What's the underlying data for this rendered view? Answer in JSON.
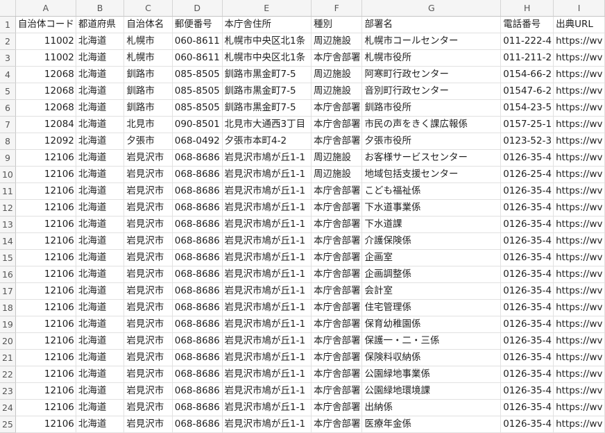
{
  "columns": [
    "A",
    "B",
    "C",
    "D",
    "E",
    "F",
    "G",
    "H",
    "I"
  ],
  "rows": [
    {
      "num": "1",
      "cells": [
        "自治体コード",
        "都道府県",
        "自治体名",
        "郵便番号",
        "本庁舎住所",
        "種別",
        "部署名",
        "電話番号",
        "出典URL"
      ]
    },
    {
      "num": "2",
      "cells": [
        "11002",
        "北海道",
        "札幌市",
        "060-8611",
        "札幌市中央区北1条",
        "周辺施設",
        "札幌市コールセンター",
        "011-222-4",
        "https://wv"
      ]
    },
    {
      "num": "3",
      "cells": [
        "11002",
        "北海道",
        "札幌市",
        "060-8611",
        "札幌市中央区北1条",
        "本庁舎部署",
        "札幌市役所",
        "011-211-2",
        "https://wv"
      ]
    },
    {
      "num": "4",
      "cells": [
        "12068",
        "北海道",
        "釧路市",
        "085-8505",
        "釧路市黒金町7-5",
        "周辺施設",
        "阿寒町行政センター",
        "0154-66-2",
        "https://wv"
      ]
    },
    {
      "num": "5",
      "cells": [
        "12068",
        "北海道",
        "釧路市",
        "085-8505",
        "釧路市黒金町7-5",
        "周辺施設",
        "音別町行政センター",
        "01547-6-2",
        "https://wv"
      ]
    },
    {
      "num": "6",
      "cells": [
        "12068",
        "北海道",
        "釧路市",
        "085-8505",
        "釧路市黒金町7-5",
        "本庁舎部署",
        "釧路市役所",
        "0154-23-5",
        "https://wv"
      ]
    },
    {
      "num": "7",
      "cells": [
        "12084",
        "北海道",
        "北見市",
        "090-8501",
        "北見市大通西3丁目",
        "本庁舎部署",
        "市民の声をきく課広報係",
        "0157-25-1",
        "https://wv"
      ]
    },
    {
      "num": "8",
      "cells": [
        "12092",
        "北海道",
        "夕張市",
        "068-0492",
        "夕張市本町4-2",
        "本庁舎部署",
        "夕張市役所",
        "0123-52-3",
        "https://wv"
      ]
    },
    {
      "num": "9",
      "cells": [
        "12106",
        "北海道",
        "岩見沢市",
        "068-8686",
        "岩見沢市鳩が丘1-1",
        "周辺施設",
        "お客様サービスセンター",
        "0126-35-4",
        "https://wv"
      ]
    },
    {
      "num": "10",
      "cells": [
        "12106",
        "北海道",
        "岩見沢市",
        "068-8686",
        "岩見沢市鳩が丘1-1",
        "周辺施設",
        "地域包括支援センター",
        "0126-25-4",
        "https://wv"
      ]
    },
    {
      "num": "11",
      "cells": [
        "12106",
        "北海道",
        "岩見沢市",
        "068-8686",
        "岩見沢市鳩が丘1-1",
        "本庁舎部署",
        "こども福祉係",
        "0126-35-4",
        "https://wv"
      ]
    },
    {
      "num": "12",
      "cells": [
        "12106",
        "北海道",
        "岩見沢市",
        "068-8686",
        "岩見沢市鳩が丘1-1",
        "本庁舎部署",
        "下水道事業係",
        "0126-35-4",
        "https://wv"
      ]
    },
    {
      "num": "13",
      "cells": [
        "12106",
        "北海道",
        "岩見沢市",
        "068-8686",
        "岩見沢市鳩が丘1-1",
        "本庁舎部署",
        "下水道課",
        "0126-35-4",
        "https://wv"
      ]
    },
    {
      "num": "14",
      "cells": [
        "12106",
        "北海道",
        "岩見沢市",
        "068-8686",
        "岩見沢市鳩が丘1-1",
        "本庁舎部署",
        "介護保険係",
        "0126-35-4",
        "https://wv"
      ]
    },
    {
      "num": "15",
      "cells": [
        "12106",
        "北海道",
        "岩見沢市",
        "068-8686",
        "岩見沢市鳩が丘1-1",
        "本庁舎部署",
        "企画室",
        "0126-35-4",
        "https://wv"
      ]
    },
    {
      "num": "16",
      "cells": [
        "12106",
        "北海道",
        "岩見沢市",
        "068-8686",
        "岩見沢市鳩が丘1-1",
        "本庁舎部署",
        "企画調整係",
        "0126-35-4",
        "https://wv"
      ]
    },
    {
      "num": "17",
      "cells": [
        "12106",
        "北海道",
        "岩見沢市",
        "068-8686",
        "岩見沢市鳩が丘1-1",
        "本庁舎部署",
        "会計室",
        "0126-35-4",
        "https://wv"
      ]
    },
    {
      "num": "18",
      "cells": [
        "12106",
        "北海道",
        "岩見沢市",
        "068-8686",
        "岩見沢市鳩が丘1-1",
        "本庁舎部署",
        "住宅管理係",
        "0126-35-4",
        "https://wv"
      ]
    },
    {
      "num": "19",
      "cells": [
        "12106",
        "北海道",
        "岩見沢市",
        "068-8686",
        "岩見沢市鳩が丘1-1",
        "本庁舎部署",
        "保育幼稚園係",
        "0126-35-4",
        "https://wv"
      ]
    },
    {
      "num": "20",
      "cells": [
        "12106",
        "北海道",
        "岩見沢市",
        "068-8686",
        "岩見沢市鳩が丘1-1",
        "本庁舎部署",
        "保護一・二・三係",
        "0126-35-4",
        "https://wv"
      ]
    },
    {
      "num": "21",
      "cells": [
        "12106",
        "北海道",
        "岩見沢市",
        "068-8686",
        "岩見沢市鳩が丘1-1",
        "本庁舎部署",
        "保険料収納係",
        "0126-35-4",
        "https://wv"
      ]
    },
    {
      "num": "22",
      "cells": [
        "12106",
        "北海道",
        "岩見沢市",
        "068-8686",
        "岩見沢市鳩が丘1-1",
        "本庁舎部署",
        "公園緑地事業係",
        "0126-35-4",
        "https://wv"
      ]
    },
    {
      "num": "23",
      "cells": [
        "12106",
        "北海道",
        "岩見沢市",
        "068-8686",
        "岩見沢市鳩が丘1-1",
        "本庁舎部署",
        "公園緑地環境課",
        "0126-35-4",
        "https://wv"
      ]
    },
    {
      "num": "24",
      "cells": [
        "12106",
        "北海道",
        "岩見沢市",
        "068-8686",
        "岩見沢市鳩が丘1-1",
        "本庁舎部署",
        "出納係",
        "0126-35-4",
        "https://wv"
      ]
    },
    {
      "num": "25",
      "cells": [
        "12106",
        "北海道",
        "岩見沢市",
        "068-8686",
        "岩見沢市鳩が丘1-1",
        "本庁舎部署",
        "医療年金係",
        "0126-35-4",
        "https://wv"
      ]
    }
  ]
}
